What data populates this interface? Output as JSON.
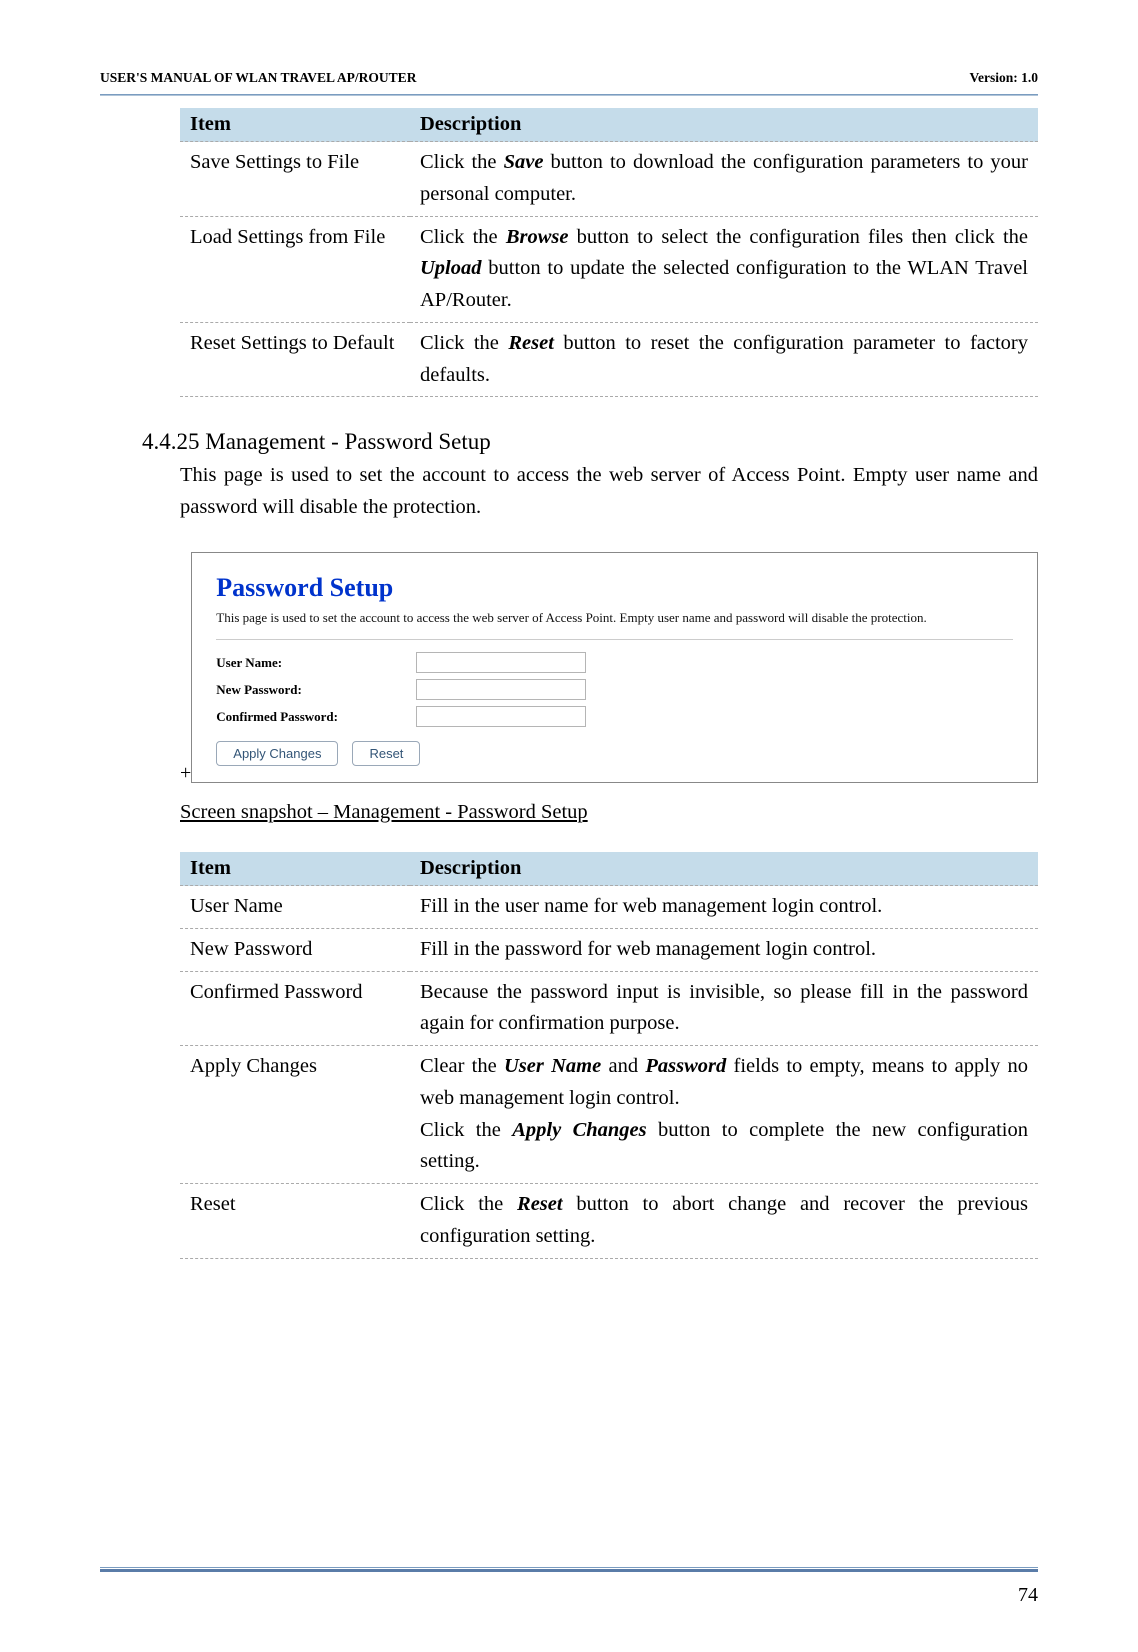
{
  "header": {
    "doc_title": "USER'S MANUAL OF WLAN TRAVEL AP/ROUTER",
    "version": "Version: 1.0"
  },
  "table1": {
    "col1": "Item",
    "col2": "Description",
    "rows": [
      {
        "item": "Save Settings to File",
        "desc_pre": "Click the ",
        "desc_bi": "Save",
        "desc_post": " button to download the configuration parameters to your personal computer."
      },
      {
        "item": "Load Settings from File",
        "desc_pre": "Click the ",
        "desc_bi": "Browse",
        "desc_mid": " button to select the configuration files then click the ",
        "desc_bi2": "Upload",
        "desc_post": " button to update the selected configuration to the WLAN Travel AP/Router."
      },
      {
        "item": "Reset Settings to Default",
        "desc_pre": "Click the ",
        "desc_bi": "Reset",
        "desc_post": " button to reset the configuration parameter to factory defaults."
      }
    ]
  },
  "section": {
    "num_title": "4.4.25  Management - Password Setup",
    "intro": "This page is used to set the account to access the web server of Access Point. Empty user name and password will disable the protection."
  },
  "screenshot": {
    "title": "Password Setup",
    "desc": "This page is used to set the account to access the web server of Access Point. Empty user name and password will disable the protection.",
    "label_user": "User Name:",
    "label_newpw": "New Password:",
    "label_confpw": "Confirmed Password:",
    "btn_apply": "Apply Changes",
    "btn_reset": "Reset",
    "plus": "+"
  },
  "caption": "Screen snapshot – Management - Password Setup",
  "table2": {
    "col1": "Item",
    "col2": "Description",
    "rows": {
      "r1": {
        "item": "User Name",
        "desc": "Fill in the user name for web management login control."
      },
      "r2": {
        "item": "New Password",
        "desc": "Fill in the password for web management login control."
      },
      "r3": {
        "item": "Confirmed Password",
        "desc": "Because the password input is invisible, so please fill in the password again for confirmation purpose."
      },
      "r4": {
        "item": "Apply Changes",
        "p1a": "Clear the ",
        "p1b": "User Name",
        "p1c": " and ",
        "p1d": "Password",
        "p1e": " fields to empty, means to apply no web management login control.",
        "p2a": "Click the ",
        "p2b": "Apply Changes",
        "p2c": " button to complete the new configuration setting."
      },
      "r5": {
        "item": "Reset",
        "a": "Click the ",
        "b": "Reset",
        "c": " button to abort change and recover the previous configuration setting."
      }
    }
  },
  "page_number": "74"
}
